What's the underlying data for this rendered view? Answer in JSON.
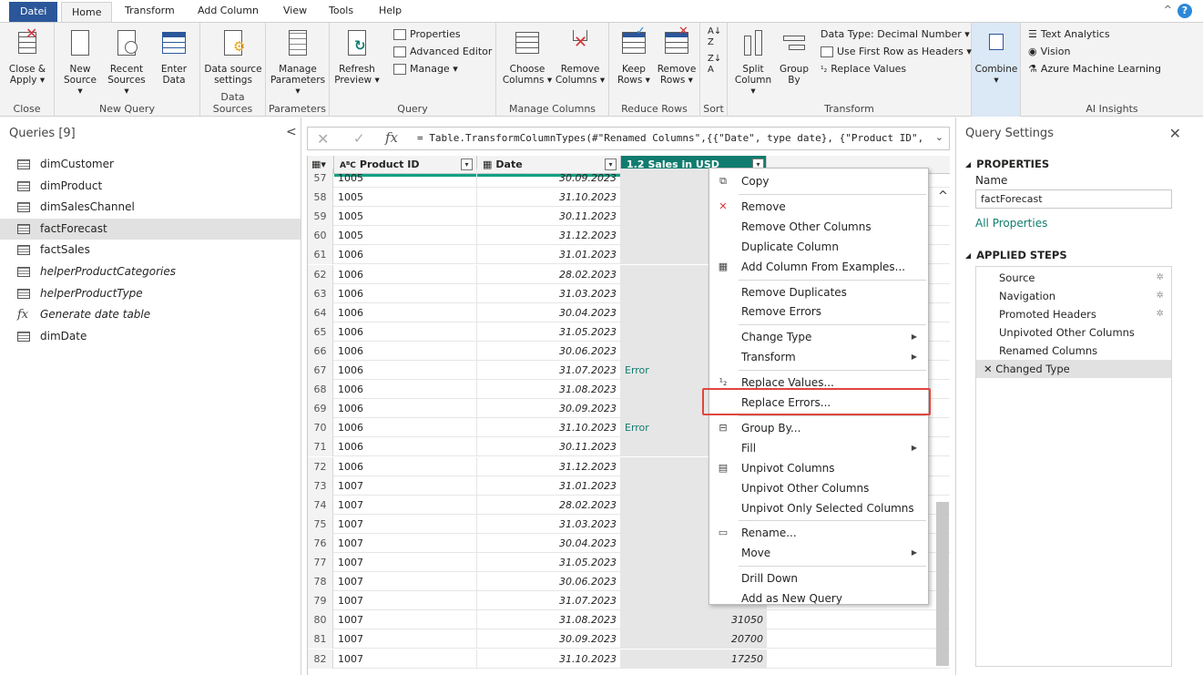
{
  "tabs": [
    "Datei",
    "Home",
    "Transform",
    "Add Column",
    "View",
    "Tools",
    "Help"
  ],
  "ribbon": {
    "close": {
      "btn1": "Close &",
      "btn1b": "Apply",
      "label": "Close"
    },
    "new_query": {
      "new_source": "New",
      "new_source_b": "Source",
      "recent_sources": "Recent",
      "recent_sources_b": "Sources",
      "enter_data": "Enter",
      "enter_data_b": "Data",
      "label": "New Query"
    },
    "data_sources": {
      "btn": "Data source",
      "btn_b": "settings",
      "label": "Data Sources"
    },
    "parameters": {
      "btn": "Manage",
      "btn_b": "Parameters",
      "label": "Parameters"
    },
    "query": {
      "refresh": "Refresh",
      "refresh_b": "Preview",
      "properties": "Properties",
      "advanced_editor": "Advanced Editor",
      "manage": "Manage",
      "label": "Query"
    },
    "manage_columns": {
      "choose": "Choose",
      "choose_b": "Columns",
      "remove": "Remove",
      "remove_b": "Columns",
      "label": "Manage Columns"
    },
    "reduce_rows": {
      "keep": "Keep",
      "keep_b": "Rows",
      "remove": "Remove",
      "remove_b": "Rows",
      "label": "Reduce Rows"
    },
    "sort": {
      "label": "Sort"
    },
    "transform": {
      "split": "Split",
      "split_b": "Column",
      "group": "Group",
      "group_b": "By",
      "data_type": "Data Type: Decimal Number",
      "first_row": "Use First Row as Headers",
      "replace": "Replace Values",
      "label": "Transform"
    },
    "combine": {
      "btn": "Combine"
    },
    "ai": {
      "text": "Text Analytics",
      "vision": "Vision",
      "aml": "Azure Machine Learning",
      "label": "AI Insights"
    }
  },
  "queries": {
    "title": "Queries [9]",
    "items": [
      {
        "label": "dimCustomer",
        "kind": "table"
      },
      {
        "label": "dimProduct",
        "kind": "table"
      },
      {
        "label": "dimSalesChannel",
        "kind": "table"
      },
      {
        "label": "factForecast",
        "kind": "table"
      },
      {
        "label": "factSales",
        "kind": "table"
      },
      {
        "label": "helperProductCategories",
        "kind": "table"
      },
      {
        "label": "helperProductType",
        "kind": "table"
      },
      {
        "label": "Generate date table",
        "kind": "function"
      },
      {
        "label": "dimDate",
        "kind": "table"
      }
    ]
  },
  "formula": {
    "text": "= Table.TransformColumnTypes(#\"Renamed Columns\",{{\"Date\", type date}, {\"Product ID\","
  },
  "grid": {
    "headers": [
      "Product ID",
      "Date",
      "Sales in USD"
    ],
    "header_types": [
      "A B C",
      "calendar",
      "1.2"
    ],
    "rows": [
      {
        "n": "57",
        "pid": "1005",
        "date": "30.09.2023",
        "sales": "",
        "err": ""
      },
      {
        "n": "58",
        "pid": "1005",
        "date": "31.10.2023",
        "sales": "",
        "err": ""
      },
      {
        "n": "59",
        "pid": "1005",
        "date": "30.11.2023",
        "sales": "",
        "err": ""
      },
      {
        "n": "60",
        "pid": "1005",
        "date": "31.12.2023",
        "sales": "",
        "err": ""
      },
      {
        "n": "61",
        "pid": "1006",
        "date": "31.01.2023",
        "sales": "",
        "err": ""
      },
      {
        "n": "62",
        "pid": "1006",
        "date": "28.02.2023",
        "sales": "",
        "err": ""
      },
      {
        "n": "63",
        "pid": "1006",
        "date": "31.03.2023",
        "sales": "",
        "err": ""
      },
      {
        "n": "64",
        "pid": "1006",
        "date": "30.04.2023",
        "sales": "",
        "err": ""
      },
      {
        "n": "65",
        "pid": "1006",
        "date": "31.05.2023",
        "sales": "",
        "err": ""
      },
      {
        "n": "66",
        "pid": "1006",
        "date": "30.06.2023",
        "sales": "",
        "err": ""
      },
      {
        "n": "67",
        "pid": "1006",
        "date": "31.07.2023",
        "sales": "",
        "err": "Error"
      },
      {
        "n": "68",
        "pid": "1006",
        "date": "31.08.2023",
        "sales": "",
        "err": ""
      },
      {
        "n": "69",
        "pid": "1006",
        "date": "30.09.2023",
        "sales": "",
        "err": ""
      },
      {
        "n": "70",
        "pid": "1006",
        "date": "31.10.2023",
        "sales": "",
        "err": "Error"
      },
      {
        "n": "71",
        "pid": "1006",
        "date": "30.11.2023",
        "sales": "",
        "err": ""
      },
      {
        "n": "72",
        "pid": "1006",
        "date": "31.12.2023",
        "sales": "",
        "err": ""
      },
      {
        "n": "73",
        "pid": "1007",
        "date": "31.01.2023",
        "sales": "",
        "err": ""
      },
      {
        "n": "74",
        "pid": "1007",
        "date": "28.02.2023",
        "sales": "",
        "err": ""
      },
      {
        "n": "75",
        "pid": "1007",
        "date": "31.03.2023",
        "sales": "",
        "err": ""
      },
      {
        "n": "76",
        "pid": "1007",
        "date": "30.04.2023",
        "sales": "",
        "err": ""
      },
      {
        "n": "77",
        "pid": "1007",
        "date": "31.05.2023",
        "sales": "",
        "err": ""
      },
      {
        "n": "78",
        "pid": "1007",
        "date": "30.06.2023",
        "sales": "",
        "err": ""
      },
      {
        "n": "79",
        "pid": "1007",
        "date": "31.07.2023",
        "sales": "",
        "err": ""
      },
      {
        "n": "80",
        "pid": "1007",
        "date": "31.08.2023",
        "sales": "31050",
        "err": ""
      },
      {
        "n": "81",
        "pid": "1007",
        "date": "30.09.2023",
        "sales": "20700",
        "err": ""
      },
      {
        "n": "82",
        "pid": "1007",
        "date": "31.10.2023",
        "sales": "17250",
        "err": ""
      }
    ]
  },
  "context_menu": [
    {
      "label": "Copy",
      "icon": "copy-icon",
      "glyph": "⧉",
      "sub": false
    },
    {
      "sep": true
    },
    {
      "label": "Remove",
      "icon": "remove-icon",
      "glyph": "✕",
      "sub": false
    },
    {
      "label": "Remove Other Columns",
      "sub": false
    },
    {
      "label": "Duplicate Column",
      "sub": false
    },
    {
      "label": "Add Column From Examples...",
      "icon": "examples-icon",
      "glyph": "▦",
      "sub": false
    },
    {
      "sep": true
    },
    {
      "label": "Remove Duplicates",
      "sub": false
    },
    {
      "label": "Remove Errors",
      "sub": false
    },
    {
      "sep": true
    },
    {
      "label": "Change Type",
      "sub": true
    },
    {
      "label": "Transform",
      "sub": true
    },
    {
      "sep": true
    },
    {
      "label": "Replace Values...",
      "icon": "replace-values-icon",
      "glyph": "¹₂",
      "sub": false
    },
    {
      "label": "Replace Errors...",
      "sub": false
    },
    {
      "sep": true
    },
    {
      "label": "Group By...",
      "icon": "group-by-icon",
      "glyph": "⊟",
      "sub": false
    },
    {
      "label": "Fill",
      "sub": true
    },
    {
      "label": "Unpivot Columns",
      "icon": "unpivot-icon",
      "glyph": "▤",
      "sub": false
    },
    {
      "label": "Unpivot Other Columns",
      "sub": false
    },
    {
      "label": "Unpivot Only Selected Columns",
      "sub": false
    },
    {
      "sep": true
    },
    {
      "label": "Rename...",
      "icon": "rename-icon",
      "glyph": "▭",
      "sub": false
    },
    {
      "label": "Move",
      "sub": true
    },
    {
      "sep": true
    },
    {
      "label": "Drill Down",
      "sub": false
    },
    {
      "label": "Add as New Query",
      "sub": false
    }
  ],
  "settings": {
    "title": "Query Settings",
    "properties": "PROPERTIES",
    "name_label": "Name",
    "name_value": "factForecast",
    "all_properties": "All Properties",
    "applied_steps": "APPLIED STEPS",
    "steps": [
      {
        "label": "Source",
        "gear": true
      },
      {
        "label": "Navigation",
        "gear": true
      },
      {
        "label": "Promoted Headers",
        "gear": true
      },
      {
        "label": "Unpivoted Other Columns",
        "gear": false
      },
      {
        "label": "Renamed Columns",
        "gear": false
      },
      {
        "label": "Changed Type",
        "gear": false,
        "selected": true
      }
    ]
  },
  "colors": {
    "accent": "#107c6f",
    "file_tab": "#2b579a",
    "highlight": "#e0463d"
  }
}
